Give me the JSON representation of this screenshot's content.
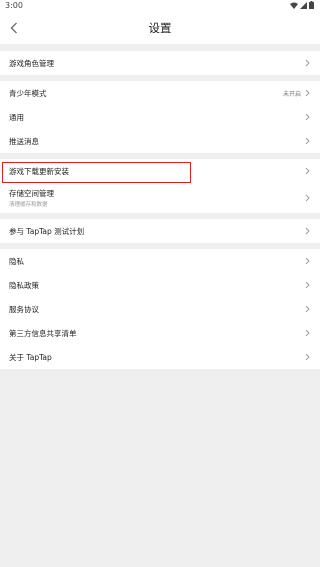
{
  "status_bar": {
    "time": "3:00"
  },
  "header": {
    "title": "设置"
  },
  "sections": [
    {
      "items": [
        {
          "label": "游戏角色管理"
        }
      ]
    },
    {
      "items": [
        {
          "label": "青少年模式",
          "value": "未开启"
        },
        {
          "label": "通用"
        },
        {
          "label": "推送消息"
        }
      ]
    },
    {
      "items": [
        {
          "label": "游戏下载更新安装"
        },
        {
          "label": "存储空间管理",
          "sub": "清理缓存和数据"
        }
      ]
    },
    {
      "items": [
        {
          "label": "参与 TapTap 测试计划"
        }
      ]
    },
    {
      "items": [
        {
          "label": "隐私"
        },
        {
          "label": "隐私政策"
        },
        {
          "label": "服务协议"
        },
        {
          "label": "第三方信息共享清单"
        },
        {
          "label": "关于 TapTap"
        }
      ]
    }
  ],
  "colors": {
    "highlight_border": "#e02020",
    "background": "#efefef"
  }
}
